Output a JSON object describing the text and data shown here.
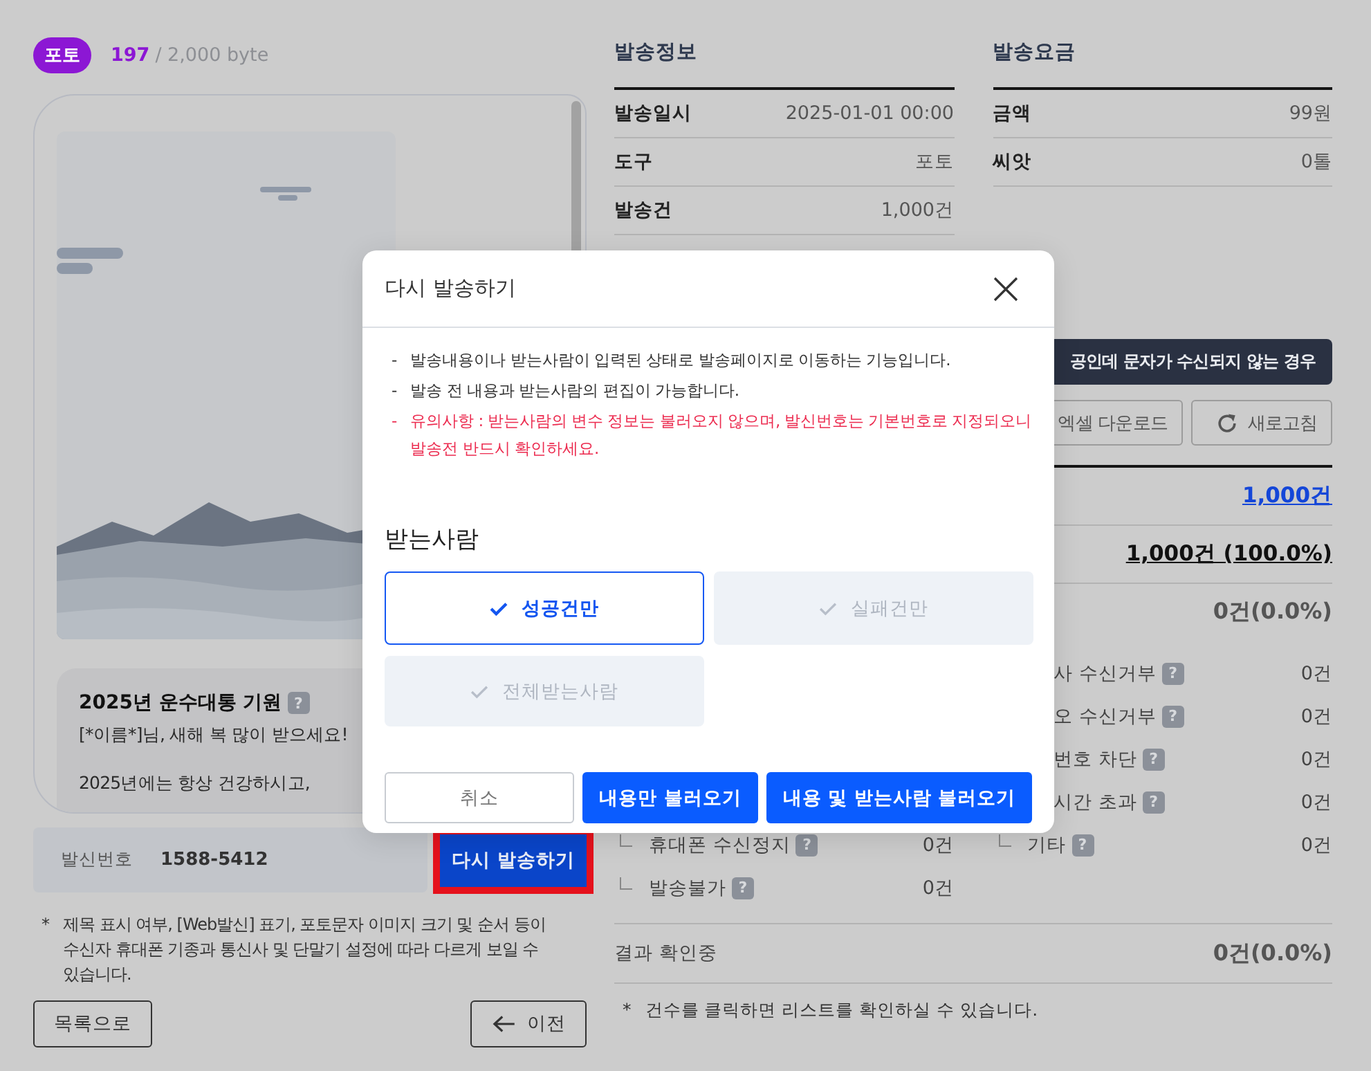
{
  "header": {
    "type_badge": "포토",
    "byte_count": "197",
    "byte_limit": "/ 2,000 byte"
  },
  "preview": {
    "picture": {
      "kind": "picture"
    },
    "message_title": "2025년 운수대통 기원",
    "help": "?",
    "message_paragraphs": [
      "[*이름*]님, 새해 복 많이 받으세요!",
      "2025년에는 항상 건강하시고,"
    ]
  },
  "sender": {
    "label": "발신번호",
    "number": "1588-5412"
  },
  "resend_button": {
    "label": "다시 발송하기",
    "highlighted": true
  },
  "note": {
    "mark": "*",
    "text": "제목 표시 여부, [Web발신] 표기, 포토문자 이미지 크기 및 순서 등이 수신자 휴대폰 기종과 통신사 및 단말기 설정에 따라 다르게 보일 수 있습니다."
  },
  "nav_buttons": [
    {
      "label": "목록으로",
      "kind": "plain"
    },
    {
      "label": "이전",
      "kind": "back"
    }
  ],
  "send_info": {
    "title": "발송정보",
    "rows": [
      {
        "label": "발송일시",
        "value": "2025-01-01 00:00"
      },
      {
        "label": "도구",
        "value": "포토"
      },
      {
        "label": "발송건",
        "value": "1,000건"
      }
    ]
  },
  "fee": {
    "title": "발송요금",
    "rows": [
      {
        "label": "금액",
        "value": "99원"
      },
      {
        "label": "씨앗",
        "value": "0톨"
      }
    ]
  },
  "results": {
    "issue_button": "공인데 문자가 수신되지 않는 경우",
    "actions": [
      {
        "label": "엑셀 다운로드",
        "kind": "plain"
      },
      {
        "label": "새로고침",
        "kind": "refresh"
      }
    ],
    "summary": [
      {
        "value": "1,000건",
        "kind": "link"
      },
      {
        "value": "1,000건 (100.0%)",
        "kind": "underline"
      },
      {
        "value": "0건(0.0%)",
        "kind": "plain"
      }
    ],
    "details_left": [
      {
        "label": "휴대폰 수신정지",
        "help": "?",
        "value": "0건",
        "kind": "sub"
      },
      {
        "label": "발송불가",
        "help": "?",
        "value": "0건",
        "kind": "sub"
      }
    ],
    "details_right": [
      {
        "label": "사 수신거부",
        "help": "?",
        "value": "0건",
        "kind": "partial"
      },
      {
        "label": "오 수신거부",
        "help": "?",
        "value": "0건",
        "kind": "partial"
      },
      {
        "label": "번호 차단",
        "help": "?",
        "value": "0건",
        "kind": "partial"
      },
      {
        "label": "시간 초과",
        "help": "?",
        "value": "0건",
        "kind": "partial"
      },
      {
        "label": "기타",
        "help": "?",
        "value": "0건",
        "kind": "sub"
      }
    ],
    "pending": {
      "label": "결과 확인중",
      "value": "0건(0.0%)"
    },
    "note": {
      "mark": "*",
      "text": "건수를 클릭하면 리스트를 확인하실 수 있습니다."
    }
  },
  "dialog": {
    "title": "다시 발송하기",
    "notices": [
      {
        "marker": "-",
        "text": "발송내용이나 받는사람이 입력된 상태로 발송페이지로 이동하는 기능입니다.",
        "warning": false
      },
      {
        "marker": "-",
        "text": "발송 전 내용과 받는사람의 편집이 가능합니다.",
        "warning": false
      },
      {
        "marker": "-",
        "text": "유의사항 : 받는사람의 변수 정보는 불러오지 않으며, 발신번호는 기본번호로 지정되오니 발송전 반드시 확인하세요.",
        "warning": true
      }
    ],
    "recipients_title": "받는사람",
    "options": [
      {
        "label": "성공건만",
        "selected": true
      },
      {
        "label": "실패건만",
        "selected": false
      },
      {
        "label": "전체받는사람",
        "selected": false
      }
    ],
    "buttons": [
      {
        "label": "취소",
        "kind": "secondary"
      },
      {
        "label": "내용만 불러오기",
        "kind": "primary"
      },
      {
        "label": "내용 및 받는사람 불러오기",
        "kind": "primary"
      }
    ]
  }
}
